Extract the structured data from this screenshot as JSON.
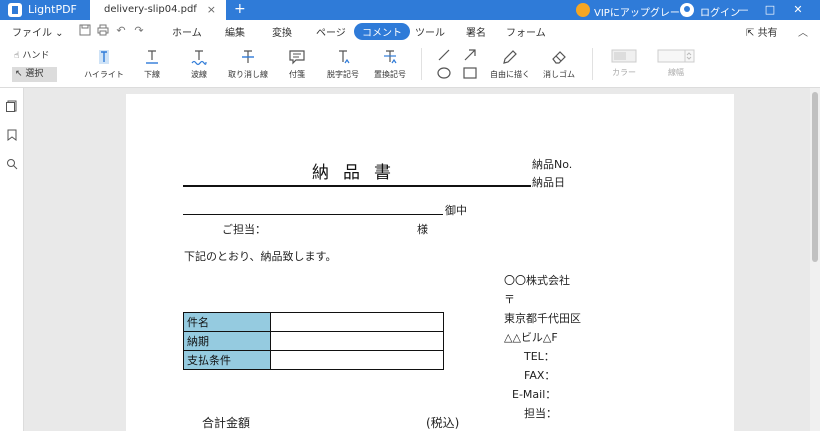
{
  "titlebar": {
    "app_name": "LightPDF",
    "tab_label": "delivery-slip04.pdf",
    "tab_close": "×",
    "tab_add": "+",
    "vip_label": "VIPにアップグレード",
    "login_label": "ログイン",
    "minimize": "—",
    "maximize": "□",
    "close": "✕"
  },
  "menubar": {
    "file_label": "ファイル ⌄",
    "items": [
      "ホーム",
      "編集",
      "変換",
      "ページ",
      "コメント",
      "ツール",
      "署名",
      "フォーム"
    ],
    "active_index": 4,
    "share_label": "共有",
    "collapse": "︿"
  },
  "toolbar": {
    "hand_label": "ハンド",
    "select_label": "選択",
    "tools": [
      {
        "label": "ハイライト"
      },
      {
        "label": "下線"
      },
      {
        "label": "波線"
      },
      {
        "label": "取り消し線"
      },
      {
        "label": "付箋"
      },
      {
        "label": "脱字記号"
      },
      {
        "label": "置換記号"
      },
      {
        "label": "自由に描く"
      },
      {
        "label": "消しゴム"
      },
      {
        "label": "カラー"
      },
      {
        "label": "線幅"
      }
    ]
  },
  "document": {
    "title": "納品書",
    "delivery_no": "納品No.",
    "delivery_date": "納品日",
    "onchu": "御中",
    "tanto": "ご担当：",
    "sama": "様",
    "intro": "下記のとおり、納品致します。",
    "company": {
      "name": "〇〇株式会社",
      "postal": "〒",
      "address1": "東京都千代田区",
      "address2": "△△ビル△F",
      "tel": "TEL：",
      "fax": "FAX：",
      "email": "E-Mail：",
      "person": "担当："
    },
    "table": {
      "rows": [
        {
          "label": "件名",
          "value": ""
        },
        {
          "label": "納期",
          "value": ""
        },
        {
          "label": "支払条件",
          "value": ""
        }
      ]
    },
    "total_label": "合計金額",
    "tax_label": "(税込)"
  },
  "colors": {
    "accent": "#2f7bd8",
    "table_header": "#95cbe0"
  }
}
